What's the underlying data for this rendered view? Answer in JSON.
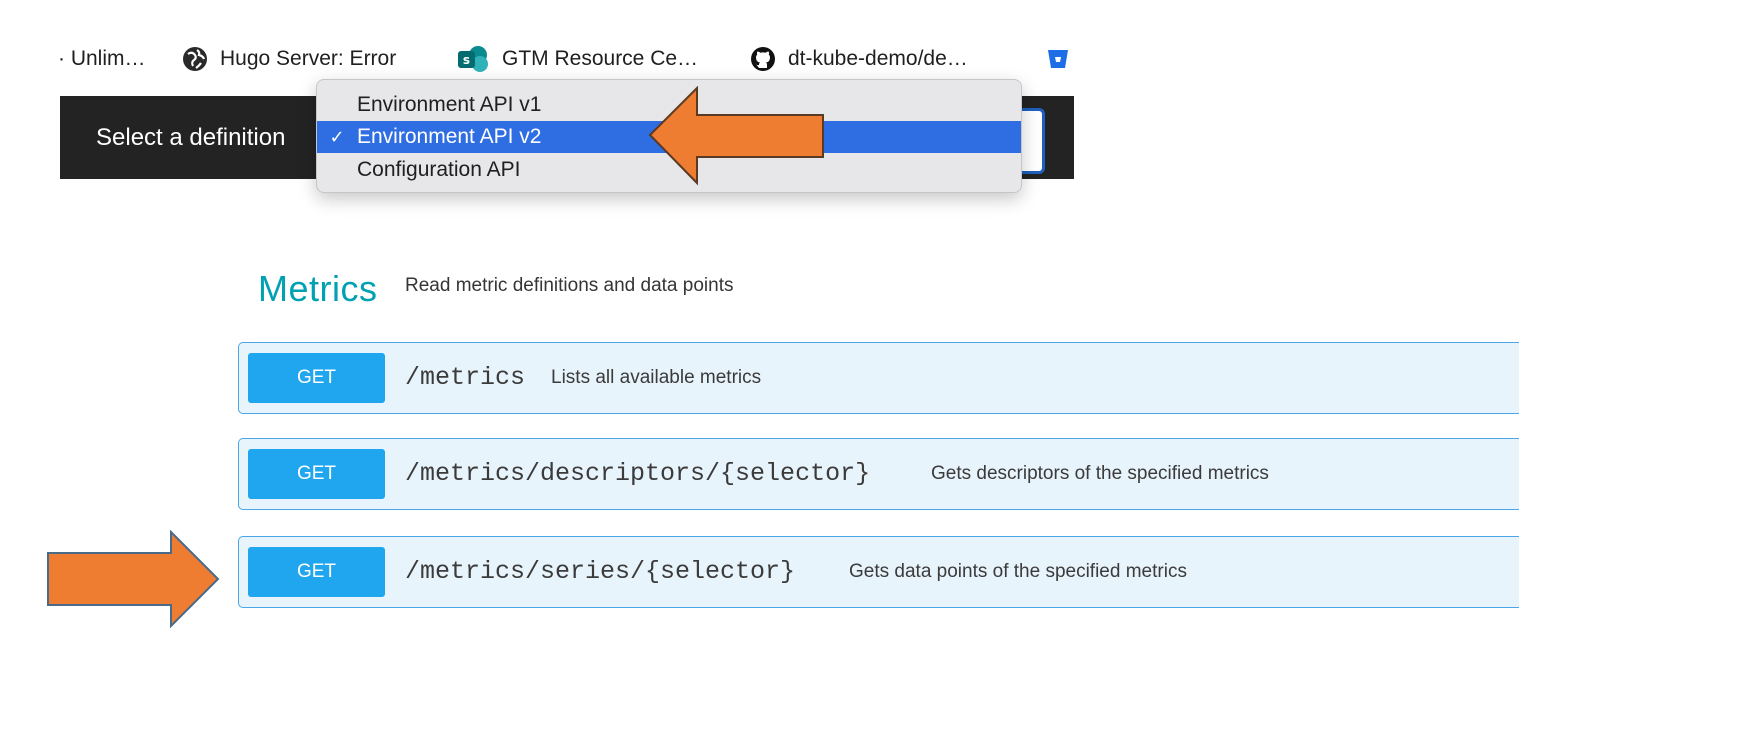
{
  "bookmarks": [
    {
      "label": "· Unlim…",
      "icon": "none"
    },
    {
      "label": "Hugo Server: Error",
      "icon": "globe-icon"
    },
    {
      "label": "GTM Resource Ce…",
      "icon": "sharepoint-icon"
    },
    {
      "label": "dt-kube-demo/de…",
      "icon": "github-icon"
    },
    {
      "label": "",
      "icon": "bitbucket-icon"
    }
  ],
  "topbar": {
    "label": "Select a definition"
  },
  "definition_menu": {
    "items": [
      {
        "label": "Environment API v1",
        "selected": false
      },
      {
        "label": "Environment API v2",
        "selected": true
      },
      {
        "label": "Configuration API",
        "selected": false
      }
    ],
    "check_mark": "✓",
    "highlight_color": "#2f6de3"
  },
  "metrics": {
    "title": "Metrics",
    "description": "Read metric definitions and data points",
    "title_color": "#00a1b2",
    "operations": [
      {
        "method": "GET",
        "path": "/metrics",
        "summary": "Lists all available metrics"
      },
      {
        "method": "GET",
        "path": "/metrics/descriptors/{selector}",
        "summary": "Gets descriptors of the specified metrics"
      },
      {
        "method": "GET",
        "path": "/metrics/series/{selector}",
        "summary": "Gets data points of the specified metrics"
      }
    ],
    "method_color": "#20a6ee"
  },
  "annotation": {
    "arrow_color": "#ee7d32"
  }
}
